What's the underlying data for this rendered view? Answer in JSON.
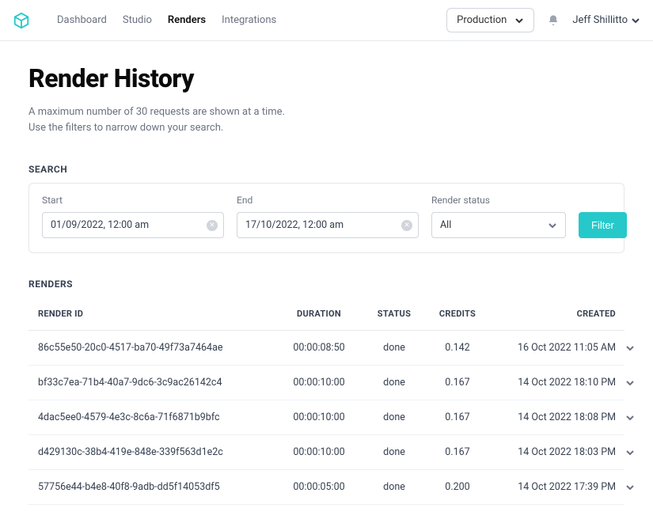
{
  "header": {
    "nav": [
      {
        "label": "Dashboard",
        "active": false
      },
      {
        "label": "Studio",
        "active": false
      },
      {
        "label": "Renders",
        "active": true
      },
      {
        "label": "Integrations",
        "active": false
      }
    ],
    "env_label": "Production",
    "user_name": "Jeff Shillitto"
  },
  "page": {
    "title": "Render History",
    "subtitle": "A maximum number of 30 requests are shown at a time. Use the filters to narrow down your search."
  },
  "search": {
    "section_label": "SEARCH",
    "start_label": "Start",
    "start_value": "01/09/2022, 12:00 am",
    "end_label": "End",
    "end_value": "17/10/2022, 12:00 am",
    "status_label": "Render status",
    "status_value": "All",
    "filter_label": "Filter"
  },
  "table": {
    "section_label": "RENDERS",
    "headers": {
      "id": "RENDER ID",
      "duration": "DURATION",
      "status": "STATUS",
      "credits": "CREDITS",
      "created": "CREATED"
    },
    "rows": [
      {
        "id": "86c55e50-20c0-4517-ba70-49f73a7464ae",
        "duration": "00:00:08:50",
        "status": "done",
        "credits": "0.142",
        "created": "16 Oct 2022 11:05 AM"
      },
      {
        "id": "bf33c7ea-71b4-40a7-9dc6-3c9ac26142c4",
        "duration": "00:00:10:00",
        "status": "done",
        "credits": "0.167",
        "created": "14 Oct 2022 18:10 PM"
      },
      {
        "id": "4dac5ee0-4579-4e3c-8c6a-71f6871b9bfc",
        "duration": "00:00:10:00",
        "status": "done",
        "credits": "0.167",
        "created": "14 Oct 2022 18:08 PM"
      },
      {
        "id": "d429130c-38b4-419e-848e-339f563d1e2c",
        "duration": "00:00:10:00",
        "status": "done",
        "credits": "0.167",
        "created": "14 Oct 2022 18:03 PM"
      },
      {
        "id": "57756e44-b4e8-40f8-9adb-dd5f14053df5",
        "duration": "00:00:05:00",
        "status": "done",
        "credits": "0.200",
        "created": "14 Oct 2022 17:39 PM"
      }
    ]
  }
}
